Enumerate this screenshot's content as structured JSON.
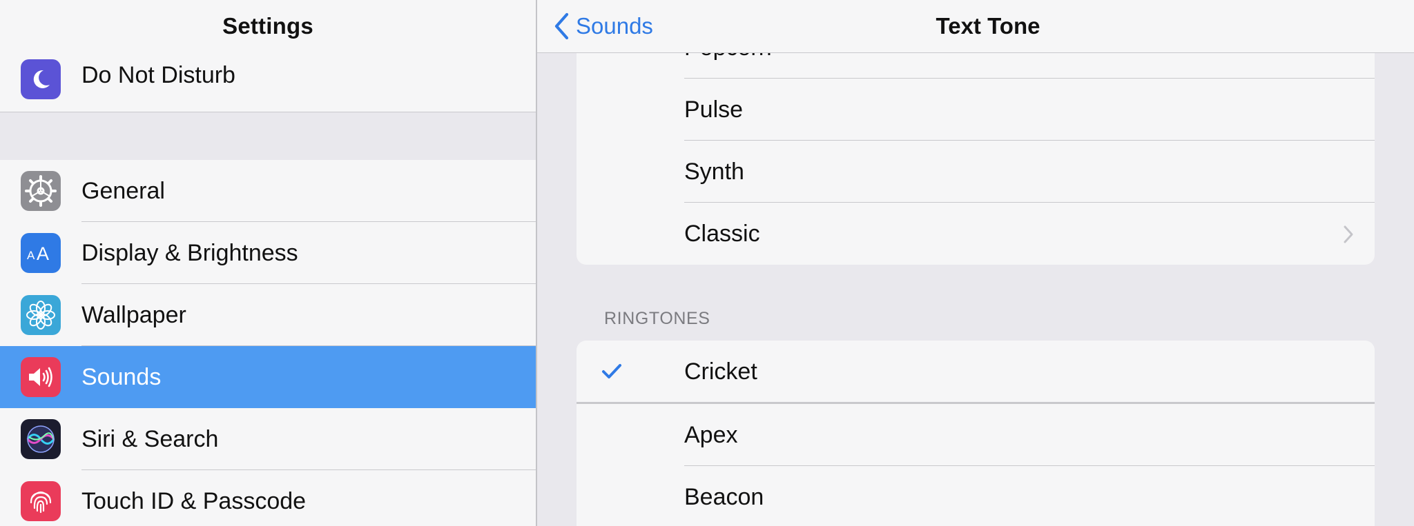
{
  "sidebar": {
    "title": "Settings",
    "items": [
      {
        "label": "Do Not Disturb",
        "icon": "moon-icon",
        "color": "#5b53d6"
      },
      {
        "label": "General",
        "icon": "gear-icon",
        "color": "#8e8e93"
      },
      {
        "label": "Display & Brightness",
        "icon": "text-size-icon",
        "color": "#2f7ae5"
      },
      {
        "label": "Wallpaper",
        "icon": "flower-icon",
        "color": "#3aa7d8"
      },
      {
        "label": "Sounds",
        "icon": "speaker-icon",
        "color": "#ea3b5a",
        "selected": true
      },
      {
        "label": "Siri & Search",
        "icon": "siri-icon",
        "color": "#1b1c2e"
      },
      {
        "label": "Touch ID & Passcode",
        "icon": "fingerprint-icon",
        "color": "#ea3b5a"
      }
    ]
  },
  "detail": {
    "back_label": "Sounds",
    "title": "Text Tone",
    "alert_tones": [
      {
        "name": "Popcorn"
      },
      {
        "name": "Pulse"
      },
      {
        "name": "Synth"
      },
      {
        "name": "Classic"
      }
    ],
    "ringtones_header": "RINGTONES",
    "ringtones": [
      {
        "name": "Cricket",
        "selected": true
      },
      {
        "name": "Apex"
      },
      {
        "name": "Beacon"
      }
    ]
  },
  "colors": {
    "accent": "#2f7ae5",
    "selection": "#4e9bf2"
  }
}
